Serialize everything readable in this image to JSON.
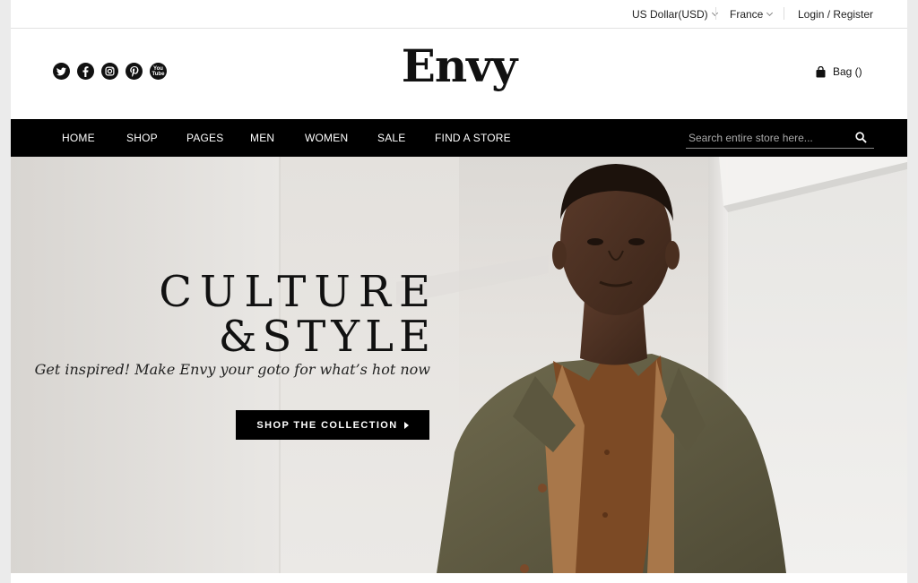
{
  "topbar": {
    "currency": "US Dollar(USD)",
    "country": "France",
    "account": "Login / Register"
  },
  "header": {
    "logo": "Envy",
    "bag_label": "Bag ()",
    "socials": [
      "twitter-icon",
      "facebook-icon",
      "instagram-icon",
      "pinterest-icon",
      "youtube-icon"
    ]
  },
  "nav": {
    "items": [
      "HOME",
      "SHOP",
      "PAGES",
      "MEN",
      "WOMEN",
      "SALE",
      "FIND A STORE"
    ],
    "search_placeholder": "Search entire store here..."
  },
  "hero": {
    "line1": "CULTURE",
    "line2": "&STYLE",
    "tagline": "Get inspired! Make Envy your goto for what’s hot now",
    "cta_label": "SHOP THE COLLECTION"
  },
  "colors": {
    "nav_bg": "#000000",
    "hero_bg": "#e6e3df",
    "text": "#111111"
  }
}
